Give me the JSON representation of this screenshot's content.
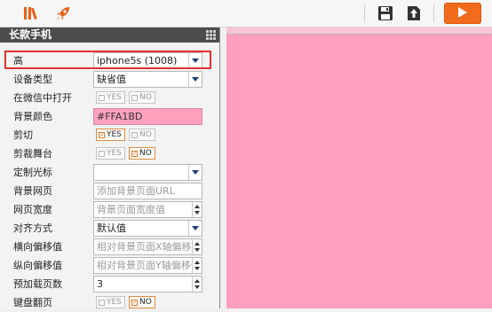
{
  "toolbar": {
    "icons": [
      "library-icon",
      "rocket-icon",
      "save-icon",
      "export-icon",
      "play-icon"
    ]
  },
  "panel": {
    "title": "长款手机",
    "rows": [
      {
        "label": "高",
        "type": "select",
        "value": "iphone5s (1008)"
      },
      {
        "label": "设备类型",
        "type": "select",
        "value": "缺省值"
      },
      {
        "label": "在微信中打开",
        "type": "toggle",
        "yes": "YES",
        "no": "NO",
        "selected": "none"
      },
      {
        "label": "背景颜色",
        "type": "color",
        "value": "#FFA1BD"
      },
      {
        "label": "剪切",
        "type": "toggle",
        "yes": "YES",
        "no": "NO",
        "selected": "yes"
      },
      {
        "label": "剪裁舞台",
        "type": "toggle",
        "yes": "YES",
        "no": "NO",
        "selected": "no"
      },
      {
        "label": "定制光标",
        "type": "select",
        "value": ""
      },
      {
        "label": "背景网页",
        "type": "text",
        "placeholder": "添加背景页面URL"
      },
      {
        "label": "网页宽度",
        "type": "number",
        "placeholder": "背景页面宽度值"
      },
      {
        "label": "对齐方式",
        "type": "select",
        "value": "默认值"
      },
      {
        "label": "横向偏移值",
        "type": "number",
        "placeholder": "相对背景页面X轴偏移值"
      },
      {
        "label": "纵向偏移值",
        "type": "number",
        "placeholder": "相对背景页面Y轴偏移值"
      },
      {
        "label": "预加载页数",
        "type": "number",
        "value": "3"
      },
      {
        "label": "键盘翻页",
        "type": "toggle",
        "yes": "YES",
        "no": "NO",
        "selected": "no"
      }
    ]
  },
  "colors": {
    "canvas_bg": "#FF9FBD",
    "accent": "#F26A1B",
    "highlight": "#E3322E"
  }
}
